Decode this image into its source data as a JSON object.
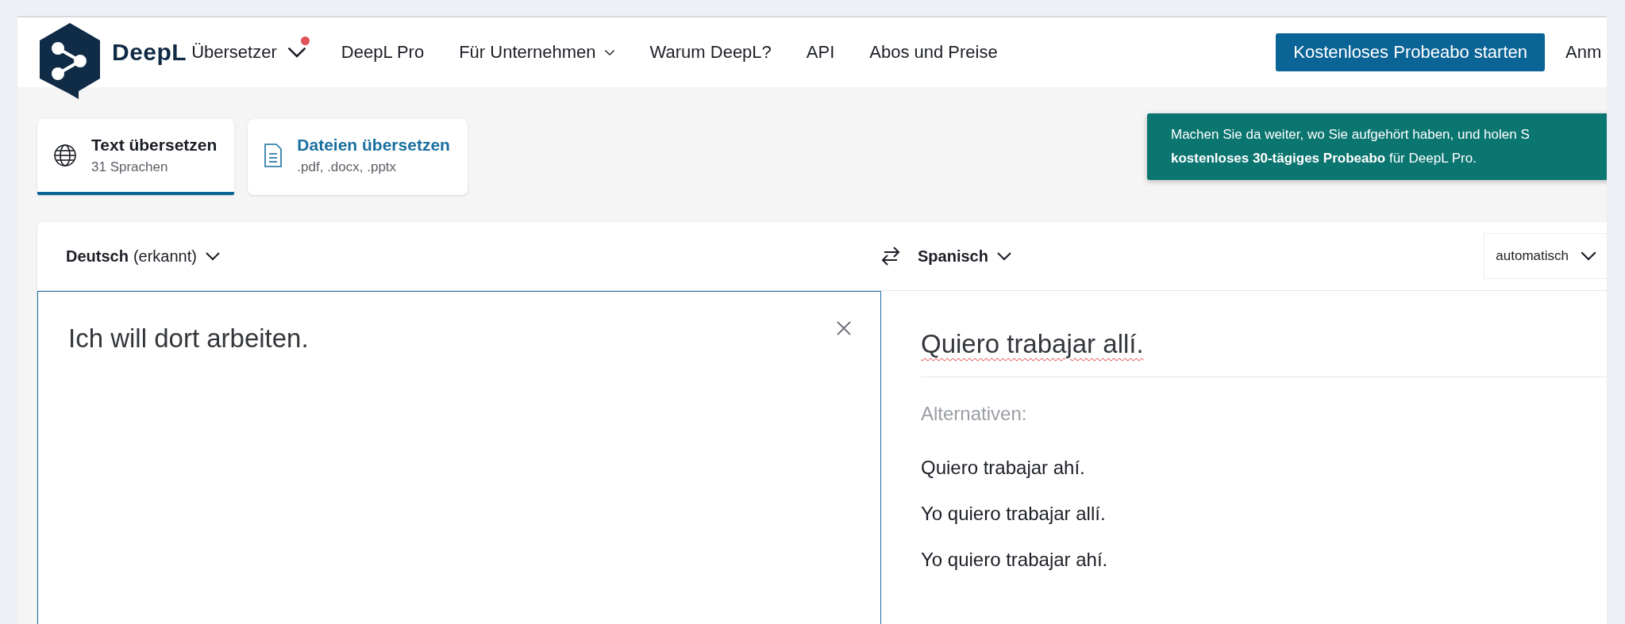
{
  "header": {
    "brand": "DeepL",
    "product": {
      "label": "Übersetzer",
      "notification": true
    },
    "nav": [
      {
        "label": "DeepL Pro",
        "has_menu": false
      },
      {
        "label": "Für Unternehmen",
        "has_menu": true
      },
      {
        "label": "Warum DeepL?",
        "has_menu": false
      },
      {
        "label": "API",
        "has_menu": false
      },
      {
        "label": "Abos und Preise",
        "has_menu": false
      }
    ],
    "cta": "Kostenloses Probeabo starten",
    "login": "Anm"
  },
  "tabs": [
    {
      "kind": "globe",
      "title": "Text übersetzen",
      "subtitle": "31 Sprachen",
      "selected": true
    },
    {
      "kind": "document",
      "title": "Dateien übersetzen",
      "subtitle": ".pdf, .docx, .pptx",
      "selected": false
    }
  ],
  "banner": {
    "lines": [
      "Machen Sie da weiter, wo Sie aufgehört haben, und holen S",
      "**kostenloses 30-tägiges Probeabo** für DeepL Pro."
    ]
  },
  "source": {
    "language": "Deutsch",
    "note": "(erkannt)",
    "text": "Ich will dort arbeiten."
  },
  "target": {
    "language": "Spanisch",
    "formality": "automatisch",
    "text": "Quiero trabajar allí.",
    "misspelled": true,
    "alternatives_label": "Alternativen:",
    "alternatives": [
      "Quiero trabajar ahí.",
      "Yo quiero trabajar allí.",
      "Yo quiero trabajar ahí."
    ]
  }
}
